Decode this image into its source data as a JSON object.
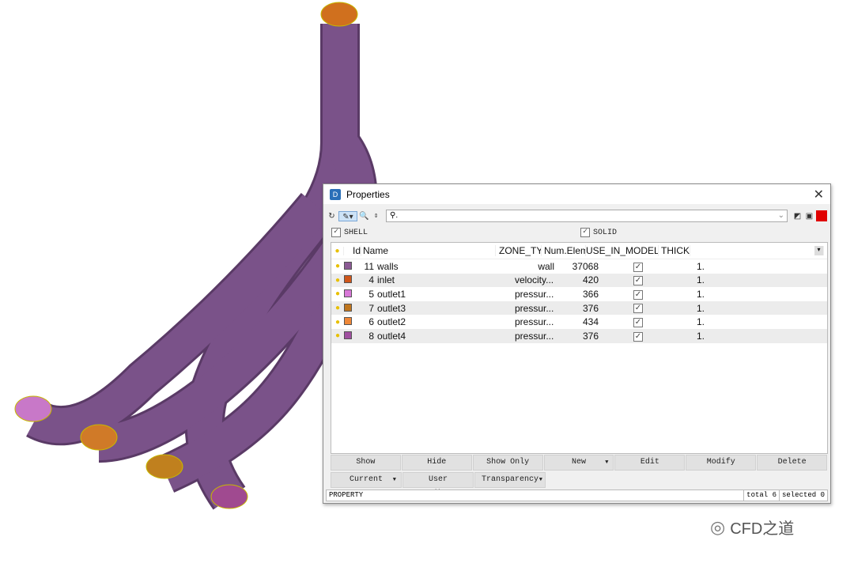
{
  "dialog": {
    "title": "Properties",
    "search_placeholder": "⚲."
  },
  "filters": {
    "shell": "SHELL",
    "solid": "SOLID"
  },
  "table": {
    "headers": [
      "Id",
      "Name",
      "ZONE_TY",
      "Num.Elem",
      "USE_IN_MODEL",
      "THICK"
    ],
    "rows": [
      {
        "id": "11",
        "name": "walls",
        "zone": "wall",
        "num": "37068",
        "use": true,
        "thick": "1.",
        "color": "#8b5a94"
      },
      {
        "id": "4",
        "name": "inlet",
        "zone": "velocity...",
        "num": "420",
        "use": true,
        "thick": "1.",
        "color": "#d0561a"
      },
      {
        "id": "5",
        "name": "outlet1",
        "zone": "pressur...",
        "num": "366",
        "use": true,
        "thick": "1.",
        "color": "#d878d8"
      },
      {
        "id": "7",
        "name": "outlet3",
        "zone": "pressur...",
        "num": "376",
        "use": true,
        "thick": "1.",
        "color": "#c0761e"
      },
      {
        "id": "6",
        "name": "outlet2",
        "zone": "pressur...",
        "num": "434",
        "use": true,
        "thick": "1.",
        "color": "#f08838"
      },
      {
        "id": "8",
        "name": "outlet4",
        "zone": "pressur...",
        "num": "376",
        "use": true,
        "thick": "1.",
        "color": "#a050a0"
      }
    ]
  },
  "buttons": {
    "show": "Show",
    "hide": "Hide",
    "show_only": "Show Only",
    "new": "New",
    "edit": "Edit",
    "modify": "Modify",
    "delete": "Delete",
    "current": "Current",
    "user_attributes": "User Attributes",
    "transparency": "Transparency"
  },
  "status": {
    "mode": "PROPERTY",
    "total": "total 6",
    "selected": "selected 0"
  },
  "watermark": "CFD之道"
}
